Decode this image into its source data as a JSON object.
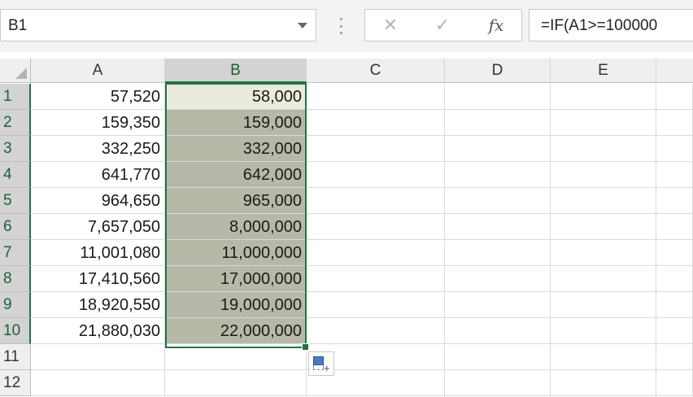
{
  "formula_bar": {
    "name_box": "B1",
    "cancel_icon": "✕",
    "enter_icon": "✓",
    "fx_label": "fx",
    "formula": "=IF(A1>=100000"
  },
  "columns": [
    "A",
    "B",
    "C",
    "D",
    "E"
  ],
  "rows": [
    {
      "num": "1",
      "a": "57,520",
      "b": "58,000"
    },
    {
      "num": "2",
      "a": "159,350",
      "b": "159,000"
    },
    {
      "num": "3",
      "a": "332,250",
      "b": "332,000"
    },
    {
      "num": "4",
      "a": "641,770",
      "b": "642,000"
    },
    {
      "num": "5",
      "a": "964,650",
      "b": "965,000"
    },
    {
      "num": "6",
      "a": "7,657,050",
      "b": "8,000,000"
    },
    {
      "num": "7",
      "a": "11,001,080",
      "b": "11,000,000"
    },
    {
      "num": "8",
      "a": "17,410,560",
      "b": "17,000,000"
    },
    {
      "num": "9",
      "a": "18,920,550",
      "b": "19,000,000"
    },
    {
      "num": "10",
      "a": "21,880,030",
      "b": "22,000,000"
    },
    {
      "num": "11",
      "a": "",
      "b": ""
    },
    {
      "num": "12",
      "a": "",
      "b": ""
    }
  ],
  "selection": {
    "range": "B1:B10",
    "active_cell": "B1",
    "accent": "#217346"
  },
  "quick_analysis_icon": "quick-analysis-icon"
}
